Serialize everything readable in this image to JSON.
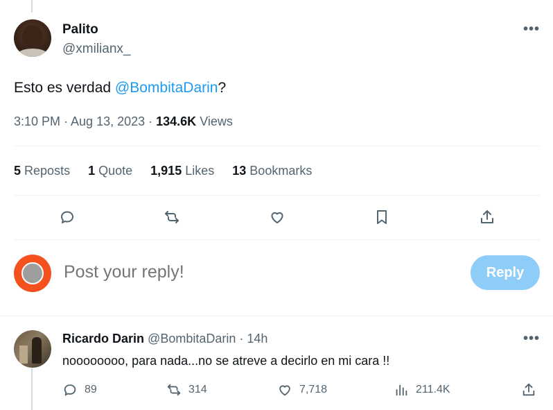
{
  "tweet": {
    "author_name": "Palito",
    "author_handle": "@xmilianx_",
    "text_prefix": "Esto es verdad ",
    "text_mention": "@BombitaDarin",
    "text_suffix": "?",
    "time": "3:10 PM · Aug 13, 2023 · ",
    "views_count": "134.6K",
    "views_label": "Views"
  },
  "stats": {
    "reposts_count": "5",
    "reposts_label": "Reposts",
    "quotes_count": "1",
    "quotes_label": "Quote",
    "likes_count": "1,915",
    "likes_label": "Likes",
    "bookmarks_count": "13",
    "bookmarks_label": "Bookmarks"
  },
  "icons": [
    "reply-icon",
    "repost-icon",
    "like-icon",
    "bookmark-icon",
    "share-icon",
    "more-icon",
    "views-icon"
  ],
  "composer": {
    "placeholder": "Post your reply!",
    "button_label": "Reply"
  },
  "reply": {
    "author_name": "Ricardo Darin",
    "author_handle": "@BombitaDarin",
    "separator": " · ",
    "time": "14h",
    "text": "noooooooo, para nada...no se atreve a decirlo en mi cara !!",
    "replies": "89",
    "reposts": "314",
    "likes": "7,718",
    "views": "211.4K"
  },
  "colors": {
    "accent": "#1d9bf0",
    "reply_button": "#8ecdf8",
    "muted_text": "#536471",
    "composer_avatar": "#f4511e"
  }
}
